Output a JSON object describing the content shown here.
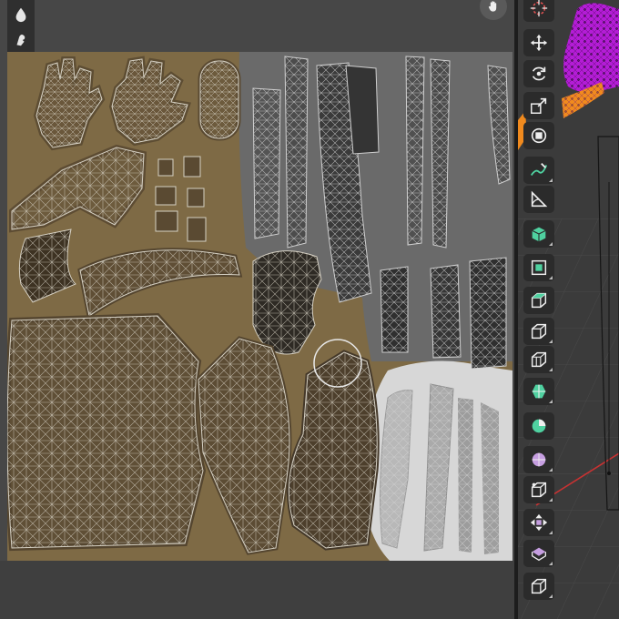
{
  "uv_editor": {
    "left_tools": [
      {
        "name": "drop-icon"
      },
      {
        "name": "grab-icon"
      },
      {
        "name": "pinch-icon"
      },
      {
        "name": "fill-bucket-icon"
      },
      {
        "name": "copy-icon"
      }
    ],
    "texture_colors": {
      "base": "#7e6a45",
      "gray_zone": "#6d6d6d",
      "white_zone": "#d9d9d9",
      "wire": "#d4d0c4"
    },
    "brush_cursor": {
      "visible": true
    }
  },
  "viewport": {
    "tools": [
      {
        "name": "cursor-icon",
        "has_corner": false
      },
      {
        "name": "move-icon",
        "has_corner": false
      },
      {
        "name": "rotate-icon",
        "has_corner": false
      },
      {
        "name": "scale-icon",
        "has_corner": false
      },
      {
        "name": "transform-icon",
        "has_corner": false
      },
      {
        "name": "annotate-icon",
        "has_corner": true
      },
      {
        "name": "measure-icon",
        "has_corner": false
      },
      {
        "name": "add-cube-icon",
        "has_corner": true
      },
      {
        "name": "extrude-region-icon",
        "has_corner": true
      },
      {
        "name": "inset-faces-icon",
        "has_corner": false
      },
      {
        "name": "bevel-icon",
        "has_corner": true
      },
      {
        "name": "loop-cut-icon",
        "has_corner": true
      },
      {
        "name": "knife-icon",
        "has_corner": true
      },
      {
        "name": "poly-build-icon",
        "has_corner": false
      },
      {
        "name": "spin-icon",
        "has_corner": true
      },
      {
        "name": "smooth-icon",
        "has_corner": true
      },
      {
        "name": "edge-slide-icon",
        "has_corner": true
      },
      {
        "name": "shrink-fatten-icon",
        "has_corner": true
      },
      {
        "name": "shear-icon",
        "has_corner": true
      },
      {
        "name": "rip-region-icon",
        "has_corner": true
      }
    ],
    "accent_colors": {
      "mesh": "#b41dd6",
      "selection": "#f08a1e",
      "axis_red": "#c83232"
    }
  }
}
